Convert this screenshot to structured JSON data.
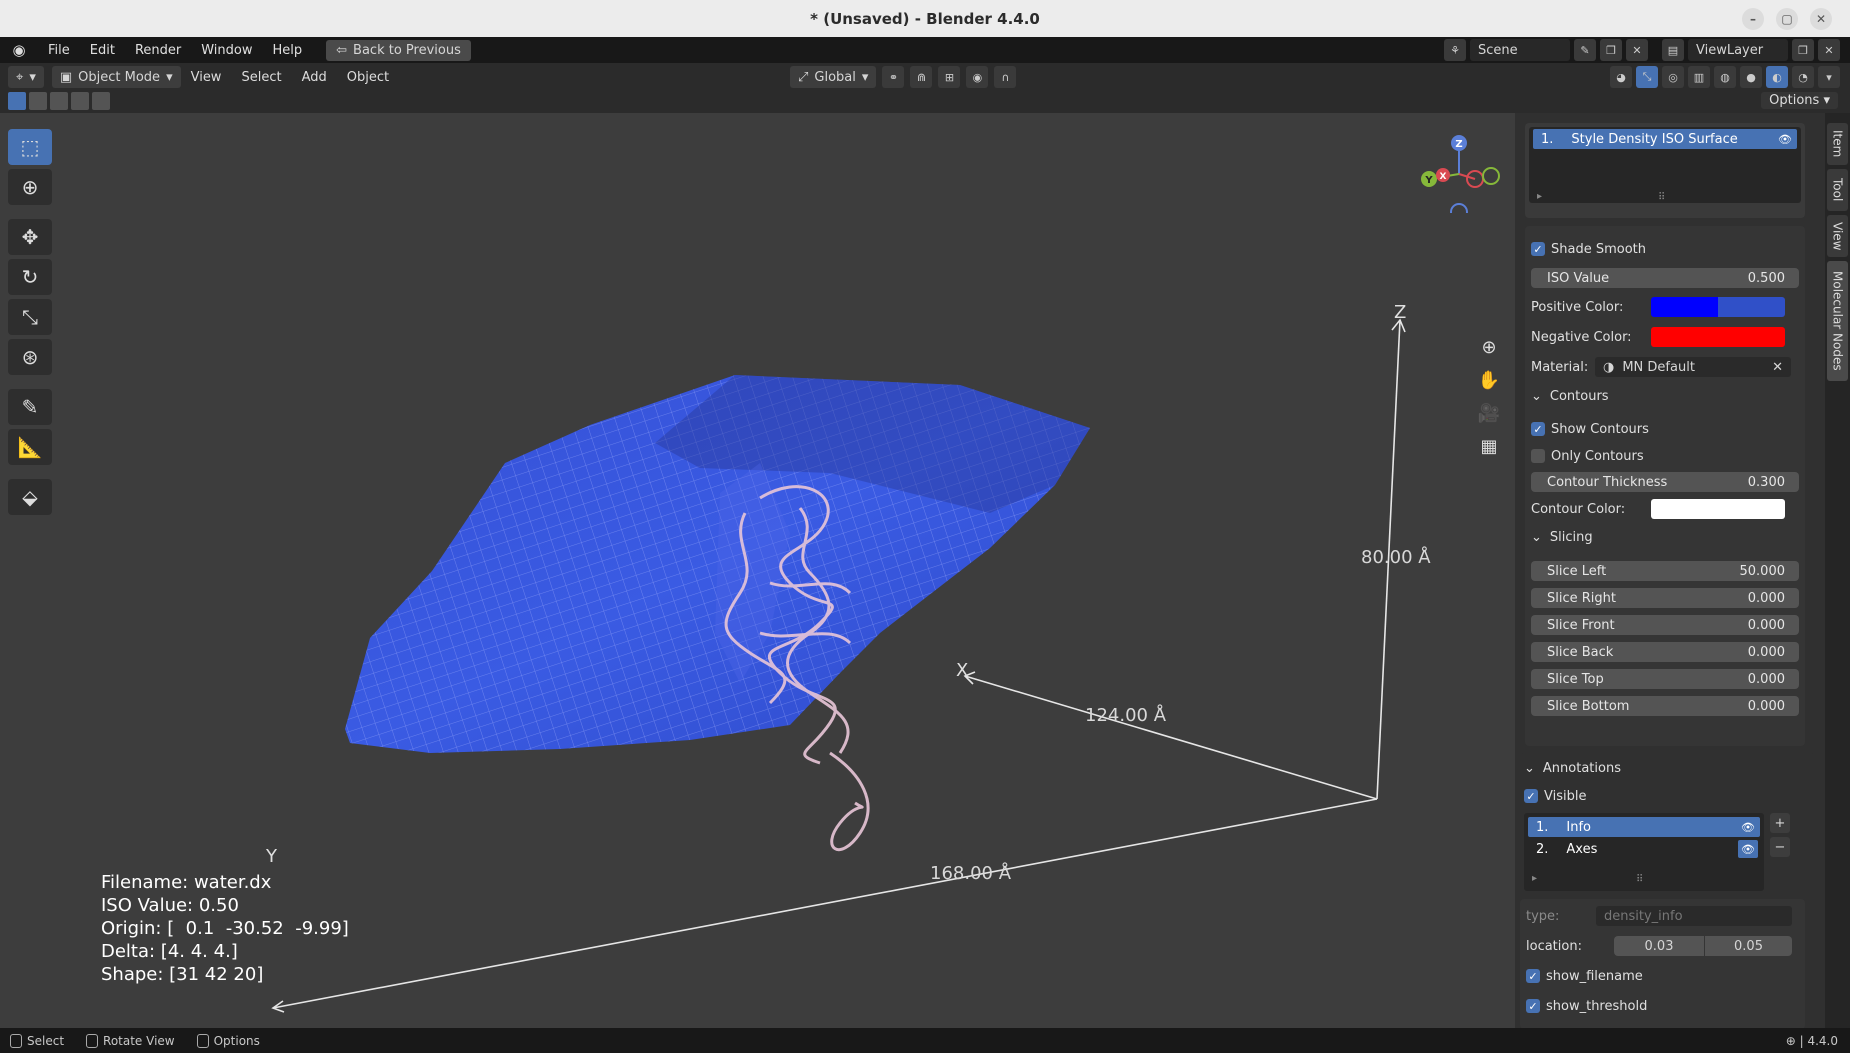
{
  "window": {
    "title": "* (Unsaved) - Blender 4.4.0"
  },
  "menu": {
    "items": [
      "File",
      "Edit",
      "Render",
      "Window",
      "Help"
    ],
    "back_button": "Back to Previous",
    "scene": "Scene",
    "view_layer": "ViewLayer"
  },
  "header": {
    "mode": "Object Mode",
    "menus": [
      "View",
      "Select",
      "Add",
      "Object"
    ],
    "transform_orientation": "Global",
    "options_label": "Options"
  },
  "viewport": {
    "dimension_labels": {
      "z": "80.00 Å",
      "x": "124.00 Å",
      "y": "168.00 Å"
    },
    "axis_labels": {
      "z": "Z",
      "x": "X",
      "y": "Y"
    },
    "gizmo_axes": {
      "z": "Z",
      "y": "Y",
      "x": "X"
    },
    "info": {
      "filename": "Filename: water.dx",
      "iso": "ISO Value: 0.50",
      "origin": "Origin: [  0.1  -30.52  -9.99]",
      "delta": "Delta: [4. 4. 4.]",
      "shape": "Shape: [31 42 20]"
    }
  },
  "sidebar": {
    "tabs": [
      "Item",
      "Tool",
      "View",
      "Molecular Nodes"
    ],
    "active_tab": "Molecular Nodes",
    "styles_list": [
      {
        "index": "1.",
        "name": "Style Density ISO Surface"
      }
    ],
    "shade_smooth": {
      "label": "Shade Smooth",
      "checked": true
    },
    "iso_value": {
      "label": "ISO Value",
      "value": "0.500"
    },
    "positive_color": {
      "label": "Positive Color:",
      "color": "#0000ff"
    },
    "negative_color": {
      "label": "Negative Color:",
      "color": "#ff0000"
    },
    "material": {
      "label": "Material:",
      "value": "MN Default"
    },
    "contours": {
      "title": "Contours",
      "show_contours": {
        "label": "Show Contours",
        "checked": true
      },
      "only_contours": {
        "label": "Only Contours",
        "checked": false
      },
      "thickness": {
        "label": "Contour Thickness",
        "value": "0.300"
      },
      "color": {
        "label": "Contour Color:",
        "color": "#ffffff"
      }
    },
    "slicing": {
      "title": "Slicing",
      "rows": [
        {
          "label": "Slice Left",
          "value": "50.000"
        },
        {
          "label": "Slice Right",
          "value": "0.000"
        },
        {
          "label": "Slice Front",
          "value": "0.000"
        },
        {
          "label": "Slice Back",
          "value": "0.000"
        },
        {
          "label": "Slice Top",
          "value": "0.000"
        },
        {
          "label": "Slice Bottom",
          "value": "0.000"
        }
      ]
    },
    "annotations": {
      "title": "Annotations",
      "visible": {
        "label": "Visible",
        "checked": true
      },
      "list": [
        {
          "index": "1.",
          "name": "Info"
        },
        {
          "index": "2.",
          "name": "Axes"
        }
      ],
      "type_label": "type:",
      "type_value": "density_info",
      "location_label": "location:",
      "location_values": [
        "0.03",
        "0.05"
      ],
      "show_filename": {
        "label": "show_filename",
        "checked": true
      },
      "show_threshold": {
        "label": "show_threshold",
        "checked": true
      }
    }
  },
  "statusbar": {
    "items": [
      "Select",
      "Rotate View",
      "Options"
    ],
    "version": "4.4.0"
  }
}
